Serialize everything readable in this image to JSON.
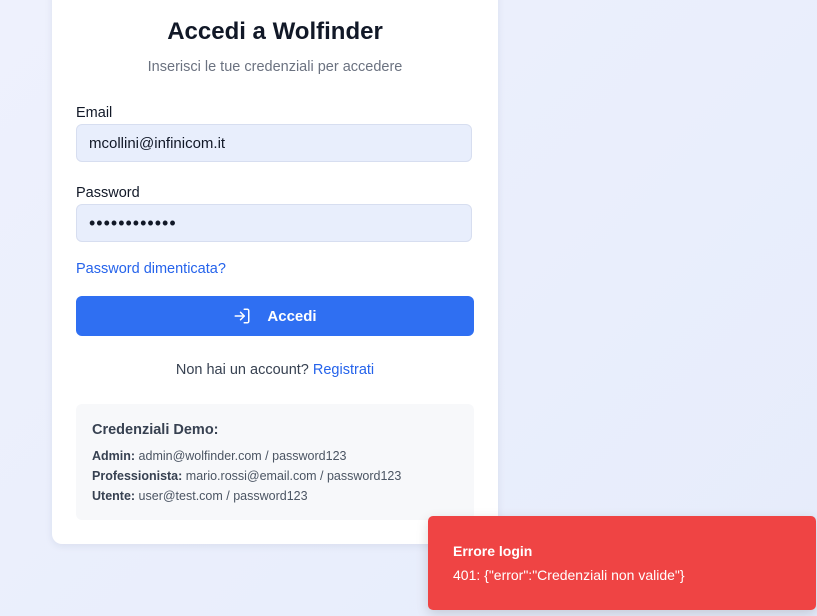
{
  "login": {
    "title": "Accedi a Wolfinder",
    "subtitle": "Inserisci le tue credenziali per accedere",
    "email_label": "Email",
    "email_value": "mcollini@infinicom.it",
    "password_label": "Password",
    "password_value": "••••••••••••",
    "forgot_label": "Password dimenticata?",
    "submit_label": "Accedi",
    "submit_icon": "login-arrow-icon",
    "register_prompt": "Non hai un account?",
    "register_link": "Registrati",
    "accent_color": "#2f6ff2"
  },
  "demo": {
    "title": "Credenziali Demo:",
    "accounts": [
      {
        "role": "Admin:",
        "credentials": "admin@wolfinder.com / password123"
      },
      {
        "role": "Professionista:",
        "credentials": "mario.rossi@email.com / password123"
      },
      {
        "role": "Utente:",
        "credentials": "user@test.com / password123"
      }
    ]
  },
  "toast": {
    "title": "Errore login",
    "message": "401: {\"error\":\"Credenziali non valide\"}",
    "color": "#ef4444"
  }
}
